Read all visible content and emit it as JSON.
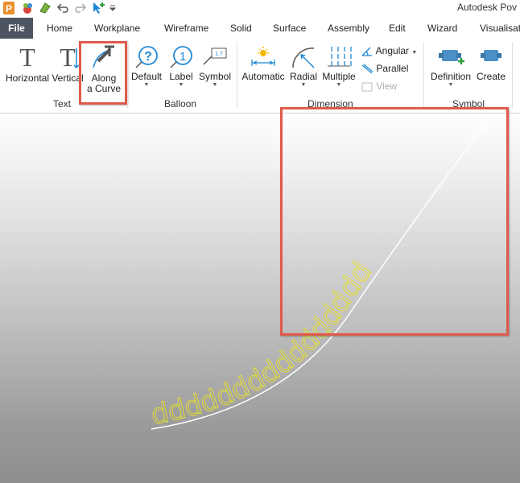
{
  "app": {
    "title": "Autodesk Pov"
  },
  "tabs": [
    "File",
    "Home",
    "Workplane",
    "Wireframe",
    "Solid",
    "Surface",
    "Assembly",
    "Edit",
    "Wizard",
    "Visualisat"
  ],
  "ribbon": {
    "text_group": {
      "label": "Text",
      "horizontal": "Horizontal",
      "vertical": "Vertical",
      "along_curve_line1": "Along",
      "along_curve_line2": "a Curve"
    },
    "balloon_group": {
      "label": "Balloon",
      "default": "Default",
      "label_btn": "Label",
      "symbol": "Symbol"
    },
    "dimension_group": {
      "label": "Dimension",
      "automatic": "Automatic",
      "radial": "Radial",
      "multiple": "Multiple",
      "angular": "Angular",
      "parallel": "Parallel",
      "view": "View"
    },
    "symbol_group": {
      "label": "Symbol",
      "definition": "Definition",
      "create": "Create"
    }
  },
  "viewport": {
    "curve_text": "dddddddddddddddd"
  },
  "colors": {
    "highlight": "#e05a4b",
    "text_on_curve": "#e8e22a",
    "file_tab": "#4d5560"
  }
}
